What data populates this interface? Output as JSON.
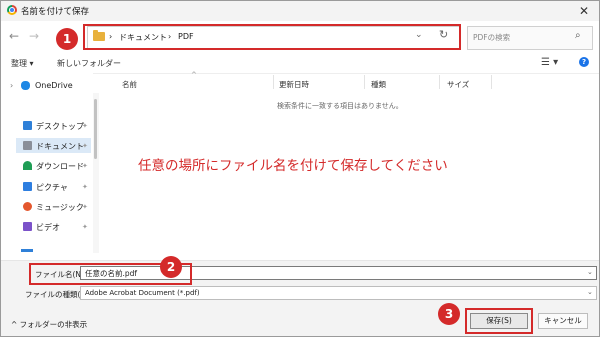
{
  "window": {
    "title": "名前を付けて保存",
    "close_glyph": "✕"
  },
  "nav": {
    "back_glyph": "←",
    "forward_glyph": "→"
  },
  "address": {
    "sep1": "›",
    "crumb1": "ドキュメント",
    "sep2": "›",
    "crumb2": "PDF",
    "dropdown_glyph": "⌄",
    "refresh_glyph": "↻"
  },
  "search": {
    "placeholder": "PDFの検索",
    "icon_glyph": "⌕"
  },
  "toolbar": {
    "organize": "整理 ▾",
    "new_folder": "新しいフォルダー",
    "view_glyph": "☰ ▾",
    "help_glyph": "?"
  },
  "sidebar": {
    "onedrive": {
      "expand": "›",
      "label": "OneDrive"
    },
    "items": [
      {
        "label": "デスクトップ",
        "pin": "✦"
      },
      {
        "label": "ドキュメント",
        "pin": "✦"
      },
      {
        "label": "ダウンロード",
        "pin": "✦"
      },
      {
        "label": "ピクチャ",
        "pin": "✦"
      },
      {
        "label": "ミュージック",
        "pin": "✦"
      },
      {
        "label": "ビデオ",
        "pin": "✦"
      }
    ]
  },
  "columns": {
    "name": "名前",
    "date": "更新日時",
    "type": "種類",
    "size": "サイズ",
    "sort_glyph": "^"
  },
  "empty_message": "検索条件に一致する項目はありません。",
  "annotation": {
    "message": "任意の場所にファイル名を付けて保存してください",
    "badge1": "1",
    "badge2": "2",
    "badge3": "3"
  },
  "form": {
    "filename_label": "ファイル名(N):",
    "filename_value": "任意の名前.pdf",
    "filetype_label": "ファイルの種類(T):",
    "filetype_value": "Adobe Acrobat Document (*.pdf)",
    "dropdown_glyph": "⌄"
  },
  "footer": {
    "hide_folders": "^ フォルダーの非表示",
    "save": "保存(S)",
    "cancel": "キャンセル"
  },
  "colors": {
    "accent_red": "#d42a2a",
    "folder": "#e8b13c",
    "help_blue": "#1a73e8"
  }
}
